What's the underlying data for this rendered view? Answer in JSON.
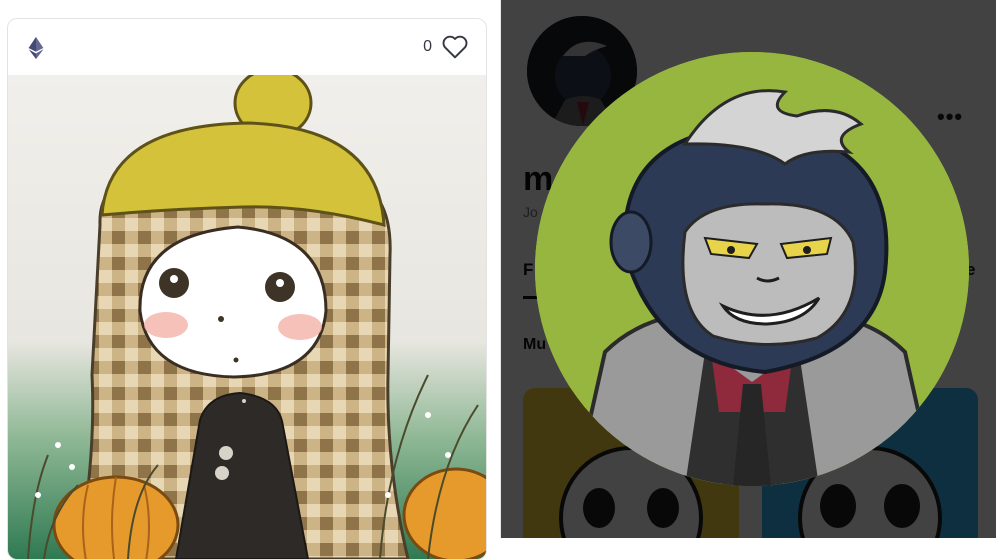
{
  "card": {
    "currency_icon": "ethereum-icon",
    "like_count": "0",
    "like_icon": "heart-outline-icon"
  },
  "profile": {
    "name_visible": "m",
    "joined_visible": "Jo",
    "first_tab_visible": "F",
    "last_tab_visible": "rite",
    "section_visible": "Mu",
    "more_icon": "ellipsis-icon"
  },
  "colors": {
    "accent": "#353840",
    "overlay": "rgba(0,0,0,0.74)",
    "avatar_bg": "#97b640",
    "tile_yellow": "#ffd93b",
    "tile_blue": "#39b6f2"
  }
}
